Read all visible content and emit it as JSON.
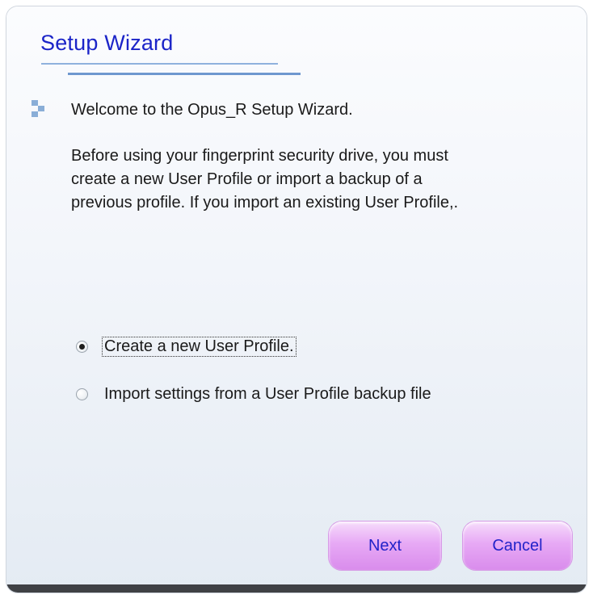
{
  "dialog": {
    "title": "Setup Wizard",
    "welcome_text": "Welcome to the Opus_R Setup Wizard.",
    "description_lines": [
      "Before using your fingerprint security drive, you must",
      "create a new User Profile or import a backup of a",
      "previous profile. If you import an existing User Profile,."
    ]
  },
  "options": [
    {
      "label": "Create a new User Profile.",
      "selected": true
    },
    {
      "label": "Import settings from a User Profile backup file",
      "selected": false
    }
  ],
  "buttons": {
    "next_label": "Next",
    "cancel_label": "Cancel"
  },
  "colors": {
    "title": "#1b24c8",
    "button_text": "#2323c9",
    "button_fill": "#e7a9f5",
    "accent_line": "#6f98cf"
  }
}
